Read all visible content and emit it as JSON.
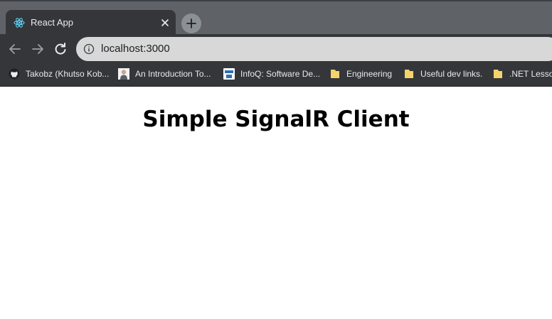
{
  "browser": {
    "tab": {
      "title": "React App",
      "favicon": "react-logo-icon"
    },
    "toolbar": {
      "url": "localhost:3000"
    },
    "bookmarks": [
      {
        "label": "Takobz (Khutso Kob...",
        "icon": "github-icon"
      },
      {
        "label": "An Introduction To...",
        "icon": "person-avatar-icon"
      },
      {
        "label": "InfoQ: Software De...",
        "icon": "infoq-icon"
      },
      {
        "label": "Engineering",
        "icon": "folder-icon"
      },
      {
        "label": "Useful dev links.",
        "icon": "folder-icon"
      },
      {
        "label": ".NET Lesson",
        "icon": "folder-icon"
      }
    ]
  },
  "page": {
    "heading": "Simple SignalR Client"
  },
  "colors": {
    "tabstrip": "#5f6368",
    "tab_active": "#35363a",
    "omnibox": "#d8d8d8",
    "folder": "#f5d36b",
    "react": "#61dafb"
  }
}
